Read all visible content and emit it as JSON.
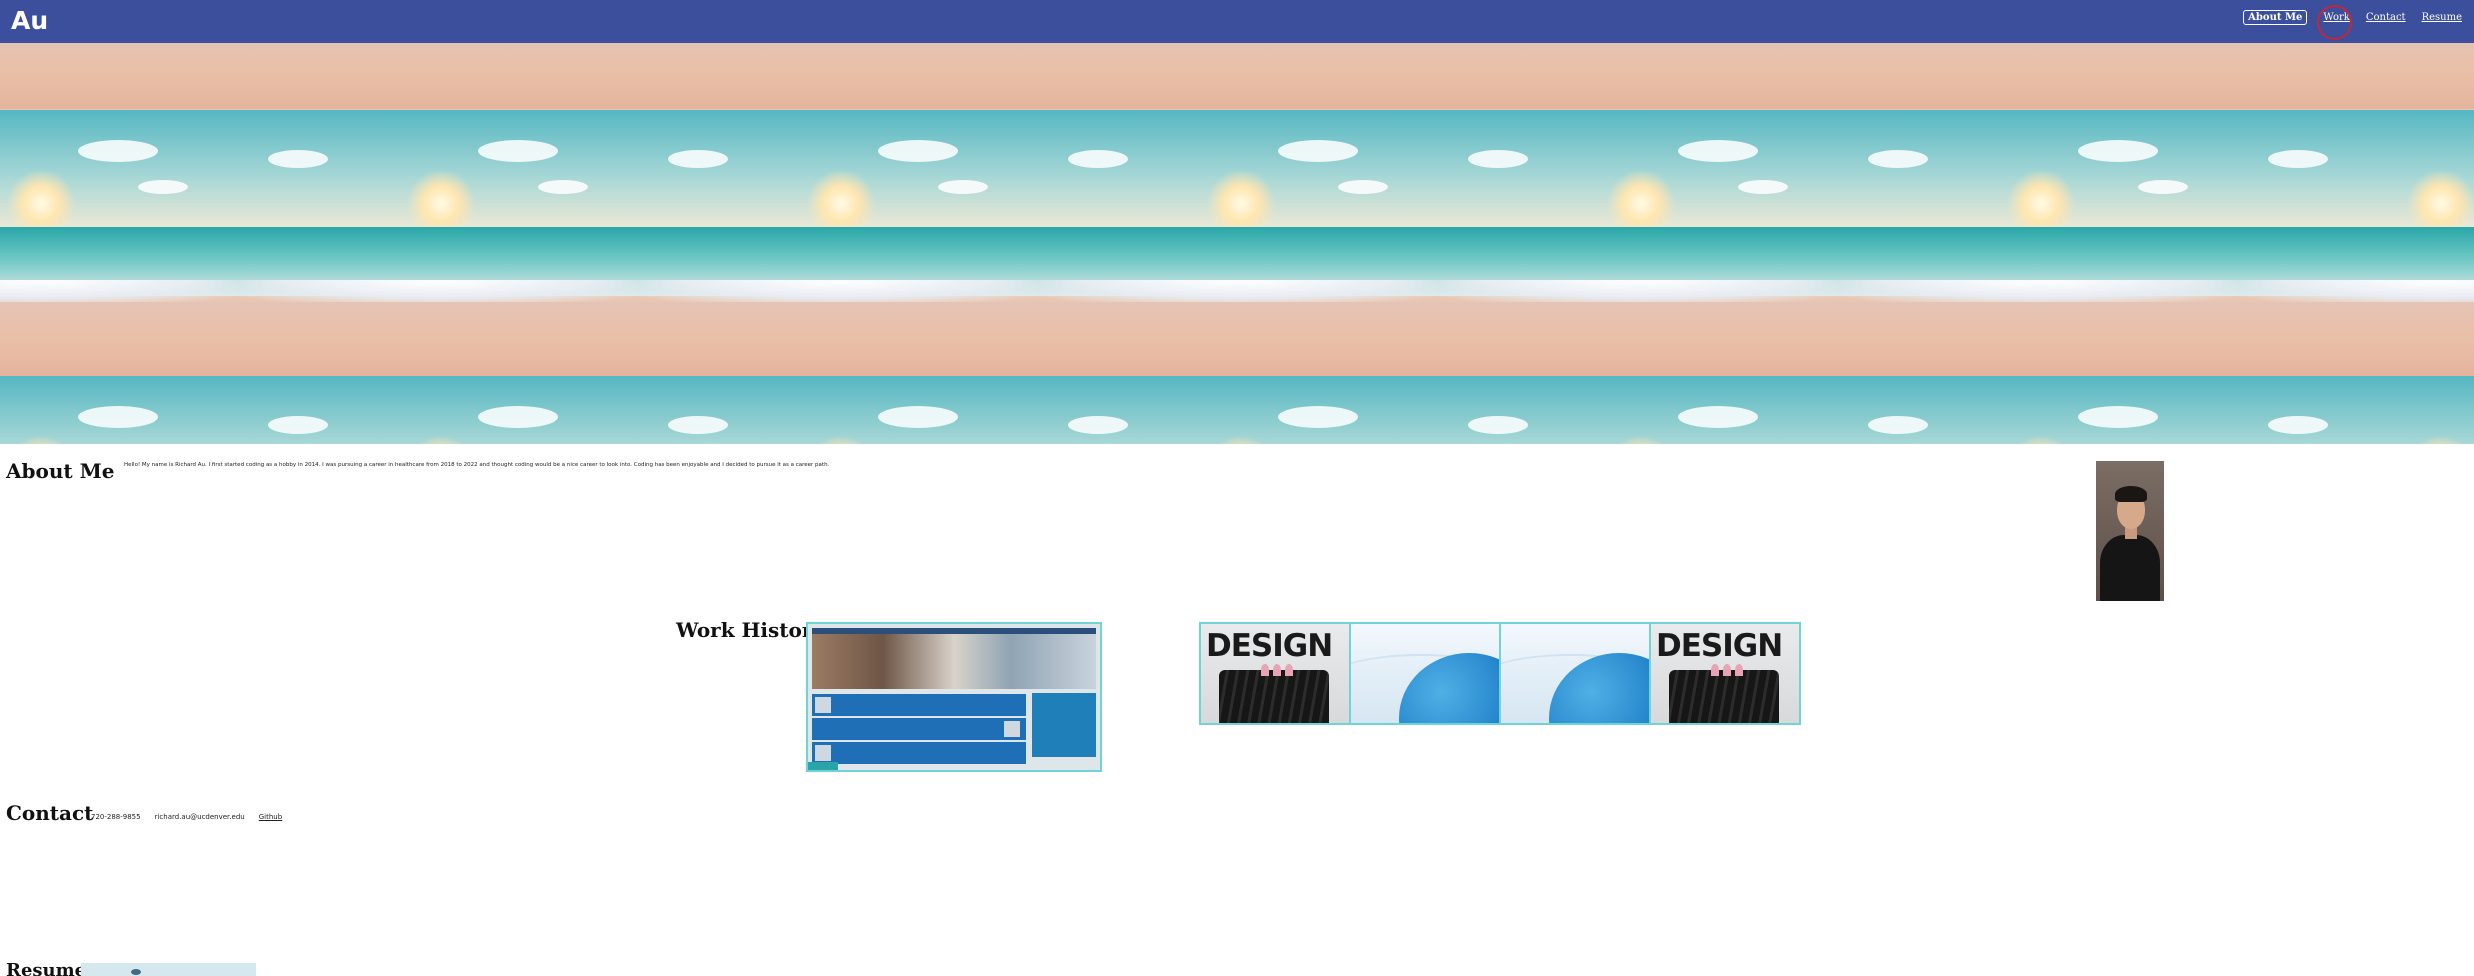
{
  "header": {
    "brand": "Au",
    "nav": [
      {
        "label": "About Me",
        "active": true
      },
      {
        "label": "Work",
        "active": false
      },
      {
        "label": "Contact",
        "active": false
      },
      {
        "label": "Resume",
        "active": false
      }
    ]
  },
  "about": {
    "title": "About Me",
    "text": "Hello! My name is Richard Au. I first started coding as a hobby in 2014. I was pursuing a career in healthcare from 2018 to 2022 and thought coding would be a nice career to look into. Coding has been enjoyable and I decided to pursue it as a career path."
  },
  "work": {
    "title": "Work History",
    "gallery": [
      "DESIGN",
      "",
      "",
      "DESIGN"
    ]
  },
  "contact": {
    "title": "Contact",
    "phone": "720-288-9855",
    "email": "richard.au@ucdenver.edu",
    "github": "Github"
  },
  "resume": {
    "title": "Resume"
  },
  "colors": {
    "header_bg": "#3b4f9c",
    "accent_border": "#6fd3d8",
    "focus_ring": "#c0283c"
  }
}
